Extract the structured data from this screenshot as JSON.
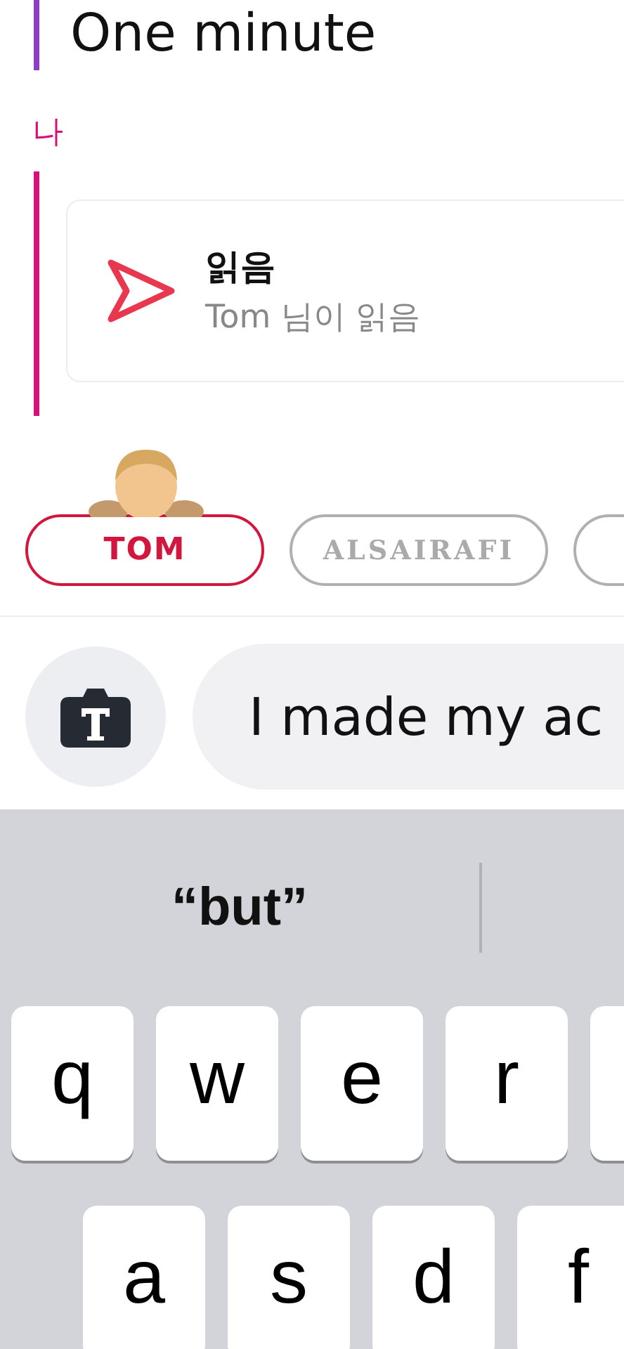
{
  "header": {
    "text": "One minute"
  },
  "sender": {
    "label": "나"
  },
  "status_card": {
    "title": "읽음",
    "subtitle": "Tom 님이 읽음"
  },
  "chips": [
    {
      "label": "TOM",
      "selected": true
    },
    {
      "label": "ALSAIRAFI",
      "selected": false
    },
    {
      "selected": false
    }
  ],
  "composer": {
    "value": "I made my ac"
  },
  "keyboard": {
    "suggestion": "“but”",
    "rows": [
      [
        {
          "kind": "key",
          "label": "q"
        },
        {
          "kind": "key",
          "label": "w"
        },
        {
          "kind": "key",
          "label": "e"
        },
        {
          "kind": "key",
          "label": "r"
        },
        {
          "kind": "cut"
        }
      ],
      [
        {
          "kind": "key",
          "label": "a"
        },
        {
          "kind": "key",
          "label": "s"
        },
        {
          "kind": "key",
          "label": "d"
        },
        {
          "kind": "key",
          "label": "f"
        }
      ]
    ]
  }
}
